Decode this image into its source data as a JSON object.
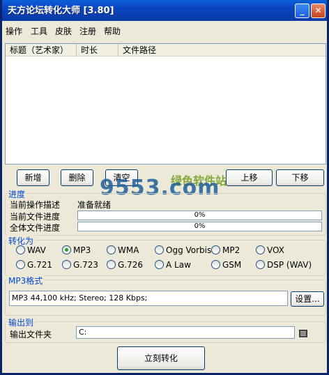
{
  "window": {
    "title": "天方论坛转化大师 [3.80]",
    "minimize_glyph": "_",
    "close_glyph": "✕"
  },
  "menu": [
    "操作",
    "工具",
    "皮肤",
    "注册",
    "帮助"
  ],
  "file_list": {
    "columns": [
      "标题（艺术家）",
      "时长",
      "文件路径"
    ],
    "rows": []
  },
  "buttons": {
    "add": "新增",
    "delete": "删除",
    "clear": "清空",
    "move_up": "上移",
    "move_down": "下移",
    "settings": "设置...",
    "convert": "立刻转化"
  },
  "watermark": {
    "logo": "9553.com",
    "text": "绿色软件站"
  },
  "progress": {
    "legend": "进度",
    "current_op_label": "当前操作描述",
    "current_op_value": "准备就绪",
    "file_progress_label": "当前文件进度",
    "file_progress_text": "0%",
    "file_progress_value": 0,
    "total_progress_label": "全体文件进度",
    "total_progress_text": "0%",
    "total_progress_value": 0
  },
  "convert_to": {
    "legend": "转化为",
    "options": [
      "WAV",
      "MP3",
      "WMA",
      "Ogg Vorbis",
      "MP2",
      "VOX",
      "G.721",
      "G.723",
      "G.726",
      "A Law",
      "GSM",
      "DSP (WAV)"
    ],
    "selected": "MP3"
  },
  "mp3_format": {
    "legend": "MP3格式",
    "value": "MP3 44,100 kHz; Stereo;  128 Kbps;"
  },
  "output": {
    "legend": "输出到",
    "folder_label": "输出文件夹",
    "folder_value": "C:"
  },
  "icons": {
    "app": "app-icon",
    "folder": "folder-browse-icon"
  },
  "colors": {
    "titlebar": "#0b45c0",
    "legend_text": "#0046d5",
    "window_bg": "#ece9d8"
  }
}
